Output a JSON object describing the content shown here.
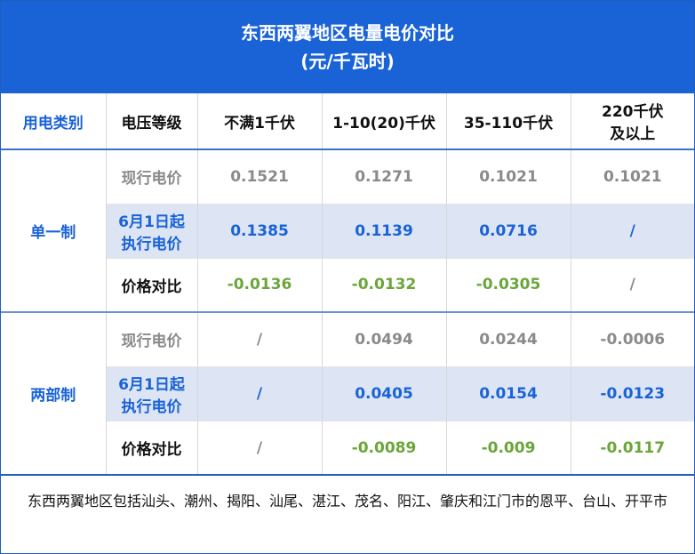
{
  "title": {
    "line1": "东西两翼地区电量电价对比",
    "line2": "(元/千瓦时)"
  },
  "header": {
    "category": "用电类别",
    "voltage": "电压等级",
    "c1": "不满1千伏",
    "c2": "1-10(20)千伏",
    "c3": "35-110千伏",
    "c4_line1": "220千伏",
    "c4_line2": "及以上"
  },
  "groups": [
    {
      "name": "单一制",
      "rows": [
        {
          "label": "现行电价",
          "values": [
            "0.1521",
            "0.1271",
            "0.1021",
            "0.1021"
          ]
        },
        {
          "label_line1": "6月1日起",
          "label_line2": "执行电价",
          "values": [
            "0.1385",
            "0.1139",
            "0.0716",
            "/"
          ]
        },
        {
          "label": "价格对比",
          "values": [
            "-0.0136",
            "-0.0132",
            "-0.0305",
            "/"
          ]
        }
      ]
    },
    {
      "name": "两部制",
      "rows": [
        {
          "label": "现行电价",
          "values": [
            "/",
            "0.0494",
            "0.0244",
            "-0.0006"
          ]
        },
        {
          "label_line1": "6月1日起",
          "label_line2": "执行电价",
          "values": [
            "/",
            "0.0405",
            "0.0154",
            "-0.0123"
          ]
        },
        {
          "label": "价格对比",
          "values": [
            "/",
            "-0.0089",
            "-0.009",
            "-0.0117"
          ]
        }
      ]
    }
  ],
  "footnote": "东西两翼地区包括汕头、潮州、揭阳、汕尾、湛江、茂名、阳江、肇庆和江门市的恩平、台山、开平市",
  "colors": {
    "title_bg": "#1a63d6",
    "accent": "#1a63d6",
    "highlight_row": "#dde5f4",
    "positive_diff": "#6aa63a",
    "current_price": "#8a8a8a"
  }
}
